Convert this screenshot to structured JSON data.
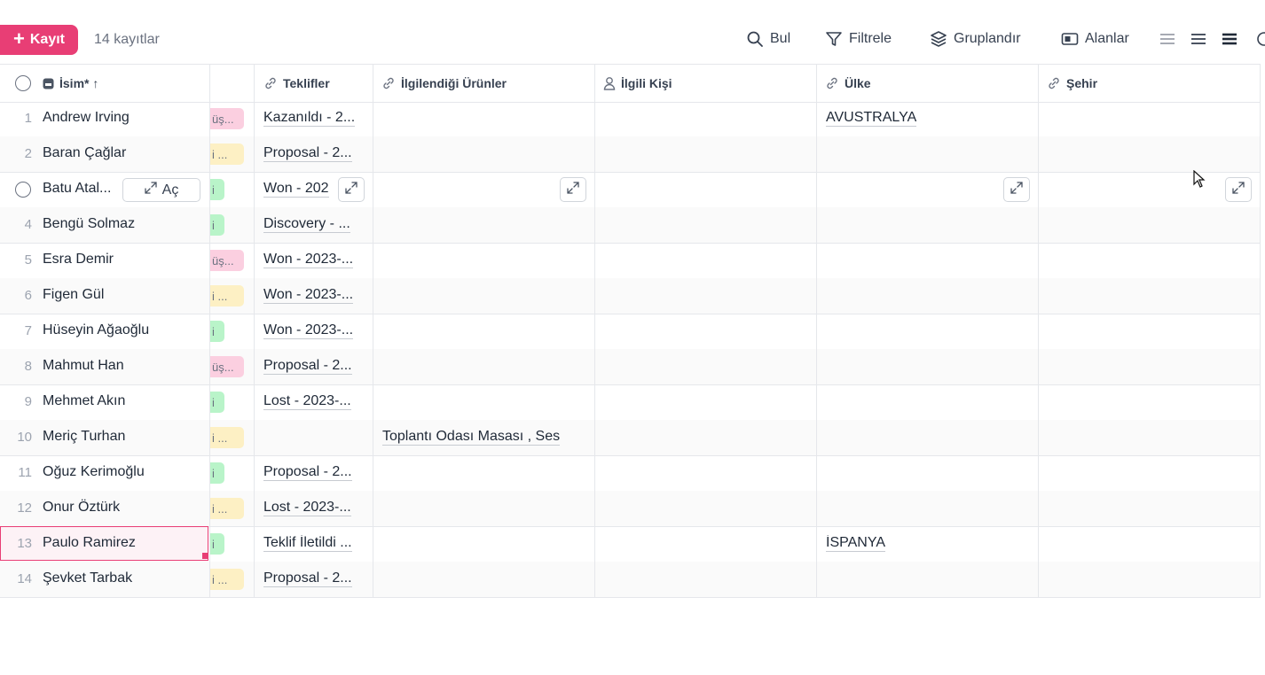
{
  "toolbar": {
    "add_label": "Kayıt",
    "record_count": "14 kayıtlar",
    "find": "Bul",
    "filter": "Filtrele",
    "group": "Gruplandır",
    "fields": "Alanlar"
  },
  "columns": {
    "name": "İsim* ↑",
    "offers": "Teklifler",
    "products": "İlgilendiği Ürünler",
    "contact": "İlgili Kişi",
    "country": "Ülke",
    "city": "Şehir"
  },
  "open_label": "Aç",
  "rows": [
    {
      "num": "1",
      "name": "Andrew Irving",
      "tag": "üş...",
      "offer": "Kazanıldı - 2...",
      "product": "",
      "country": "AVUSTRALYA"
    },
    {
      "num": "2",
      "name": "Baran Çağlar",
      "tag": "i ...",
      "offer": "Proposal - 2...",
      "product": "",
      "country": ""
    },
    {
      "num": "3",
      "name": "Batu Atal...",
      "tag": "i",
      "offer": "Won - 202",
      "product": "",
      "country": ""
    },
    {
      "num": "4",
      "name": "Bengü Solmaz",
      "tag": "i",
      "offer": "Discovery - ...",
      "product": "",
      "country": ""
    },
    {
      "num": "5",
      "name": "Esra Demir",
      "tag": "üş...",
      "offer": "Won - 2023-...",
      "product": "",
      "country": ""
    },
    {
      "num": "6",
      "name": "Figen Gül",
      "tag": "i ...",
      "offer": "Won - 2023-...",
      "product": "",
      "country": ""
    },
    {
      "num": "7",
      "name": "Hüseyin Ağaoğlu",
      "tag": "i",
      "offer": "Won - 2023-...",
      "product": "",
      "country": ""
    },
    {
      "num": "8",
      "name": "Mahmut Han",
      "tag": "üş...",
      "offer": "Proposal - 2...",
      "product": "",
      "country": ""
    },
    {
      "num": "9",
      "name": "Mehmet Akın",
      "tag": "i",
      "offer": "Lost - 2023-...",
      "product": "",
      "country": ""
    },
    {
      "num": "10",
      "name": "Meriç Turhan",
      "tag": "i ...",
      "offer": "",
      "product": "Toplantı Odası Masası  ,  Ses",
      "country": ""
    },
    {
      "num": "11",
      "name": "Oğuz Kerimoğlu",
      "tag": "i",
      "offer": "Proposal - 2...",
      "product": "",
      "country": ""
    },
    {
      "num": "12",
      "name": "Onur Öztürk",
      "tag": "i ...",
      "offer": "Lost - 2023-...",
      "product": "",
      "country": ""
    },
    {
      "num": "13",
      "name": "Paulo Ramirez",
      "tag": "i",
      "offer": "Teklif İletildi ...",
      "product": "",
      "country": "İSPANYA"
    },
    {
      "num": "14",
      "name": "Şevket Tarbak",
      "tag": "i ...",
      "offer": "Proposal - 2...",
      "product": "",
      "country": ""
    }
  ]
}
